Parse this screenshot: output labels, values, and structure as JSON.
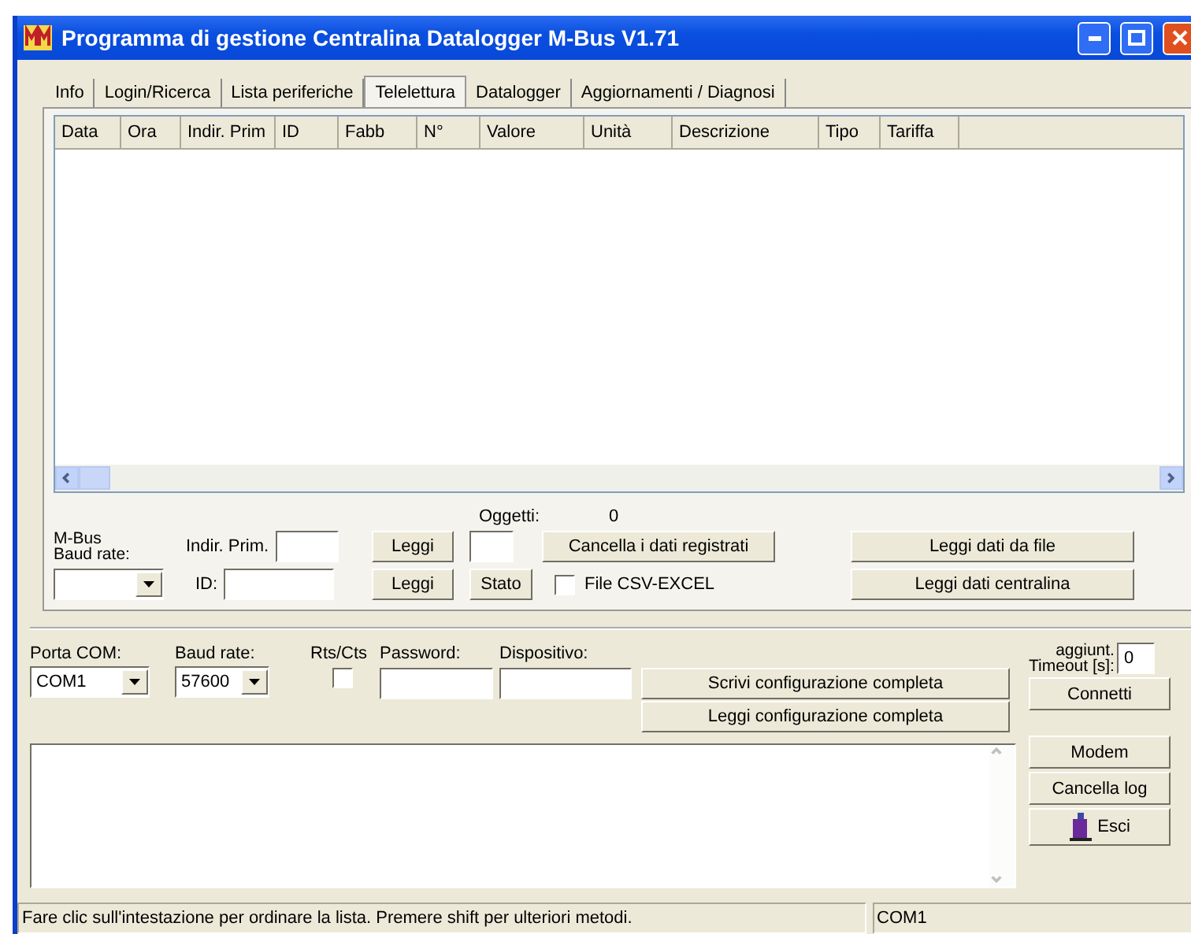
{
  "window": {
    "title": "Programma di gestione Centralina Datalogger M-Bus V1.71"
  },
  "tabs": [
    {
      "label": "Info",
      "selected": false
    },
    {
      "label": "Login/Ricerca",
      "selected": false
    },
    {
      "label": "Lista periferiche",
      "selected": false
    },
    {
      "label": "Telelettura",
      "selected": true
    },
    {
      "label": "Datalogger",
      "selected": false
    },
    {
      "label": "Aggiornamenti / Diagnosi",
      "selected": false
    }
  ],
  "table": {
    "columns": [
      "Data",
      "Ora",
      "Indir. Prim",
      "ID",
      "Fabb",
      "N°",
      "Valore",
      "Unità",
      "Descrizione",
      "Tipo",
      "Tariffa"
    ]
  },
  "reading": {
    "baud_label": "M-Bus\nBaud rate:",
    "primary_label": "Indir. Prim.",
    "id_label": "ID:",
    "read_buttons": [
      "Leggi",
      "Leggi"
    ],
    "objects_label": "Oggetti:",
    "objects_count": "0",
    "status_button": "Stato",
    "clear_button": "Cancella i dati registrati",
    "csv": {
      "label": "File CSV-EXCEL",
      "checked": false
    },
    "file_button": "Leggi dati da file",
    "device_button": "Leggi dati centralina"
  },
  "connection": {
    "port_label": "Porta COM:",
    "port_value": "COM1",
    "baud_label": "Baud rate:",
    "baud_value": "57600",
    "rts": {
      "label": "Rts/Cts",
      "checked": false
    },
    "password_label": "Password:",
    "device_label": "Dispositivo:",
    "write_button": "Scrivi configurazione completa",
    "read_button": "Leggi configurazione completa",
    "timeout_label": "aggiunt.\nTimeout [s]:",
    "timeout_value": "0",
    "connect_button": "Connetti"
  },
  "side_buttons": [
    "Modem",
    "Cancella log",
    "Esci"
  ],
  "status_bar": [
    "Fare clic sull'intestazione per ordinare la lista. Premere shift per ulteriori metodi.",
    "COM1"
  ]
}
